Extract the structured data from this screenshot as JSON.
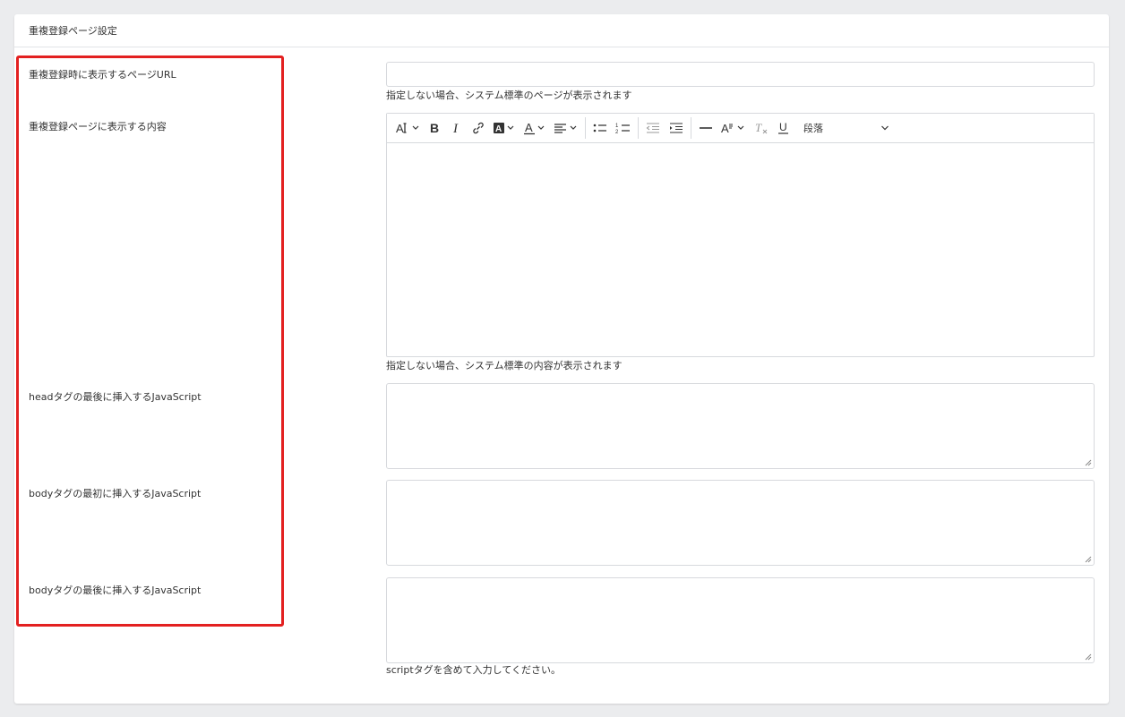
{
  "section": {
    "title": "重複登録ページ設定"
  },
  "fields": {
    "url": {
      "label": "重複登録時に表示するページURL",
      "value": "",
      "hint": "指定しない場合、システム標準のページが表示されます"
    },
    "content": {
      "label": "重複登録ページに表示する内容",
      "value": "",
      "hint": "指定しない場合、システム標準の内容が表示されます",
      "heading_select": "段落"
    },
    "head_js": {
      "label": "headタグの最後に挿入するJavaScript",
      "value": ""
    },
    "body_start_js": {
      "label": "bodyタグの最初に挿入するJavaScript",
      "value": ""
    },
    "body_end_js": {
      "label": "bodyタグの最後に挿入するJavaScript",
      "value": "",
      "hint": "scriptタグを含めて入力してください。"
    }
  },
  "toolbar_icons": [
    "font-size-icon",
    "bold-icon",
    "italic-icon",
    "link-icon",
    "highlight-icon",
    "font-color-icon",
    "align-icon",
    "bulleted-list-icon",
    "numbered-list-icon",
    "outdent-icon",
    "indent-icon",
    "horizontal-line-icon",
    "font-style-icon",
    "remove-format-icon",
    "underline-icon"
  ],
  "colors": {
    "highlight_border": "#e32020",
    "page_background": "#ebecee",
    "border": "#d7d9dd"
  }
}
